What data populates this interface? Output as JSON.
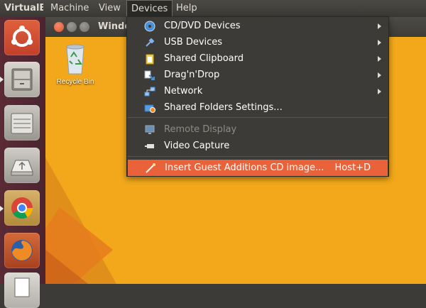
{
  "menubar": {
    "app": "VirtualB",
    "items": [
      "Machine",
      "View",
      "Devices",
      "Help"
    ]
  },
  "window": {
    "title": "Windo"
  },
  "desktop": {
    "recycle_bin_label": "Recycle Bin"
  },
  "devices_menu": {
    "items": [
      {
        "label": "CD/DVD Devices",
        "icon": "optical-disc-icon",
        "submenu": true,
        "enabled": true
      },
      {
        "label": "USB Devices",
        "icon": "usb-icon",
        "submenu": true,
        "enabled": true
      },
      {
        "label": "Shared Clipboard",
        "icon": "clipboard-icon",
        "submenu": true,
        "enabled": true
      },
      {
        "label": "Drag'n'Drop",
        "icon": "drag-drop-icon",
        "submenu": true,
        "enabled": true
      },
      {
        "label": "Network",
        "icon": "network-icon",
        "submenu": true,
        "enabled": true
      },
      {
        "label": "Shared Folders Settings...",
        "icon": "shared-folder-icon",
        "submenu": false,
        "enabled": true
      },
      {
        "label": "Remote Display",
        "icon": "remote-display-icon",
        "submenu": false,
        "enabled": false
      },
      {
        "label": "Video Capture",
        "icon": "video-capture-icon",
        "submenu": false,
        "enabled": true
      },
      {
        "label": "Insert Guest Additions CD image...",
        "icon": "insert-cd-icon",
        "submenu": false,
        "enabled": true,
        "highlighted": true,
        "shortcut": "Host+D"
      }
    ]
  },
  "launcher": {
    "items": [
      "ubuntu-dash-icon",
      "file-cabinet-icon",
      "storage-drive-icon",
      "usb-drive-icon",
      "chrome-icon",
      "firefox-icon",
      "document-icon"
    ]
  },
  "colors": {
    "highlight": "#e9623a",
    "menu_bg": "#3c3b37",
    "desktop_orange": "#f2a81a",
    "launcher_bg": "#5a2b35"
  }
}
